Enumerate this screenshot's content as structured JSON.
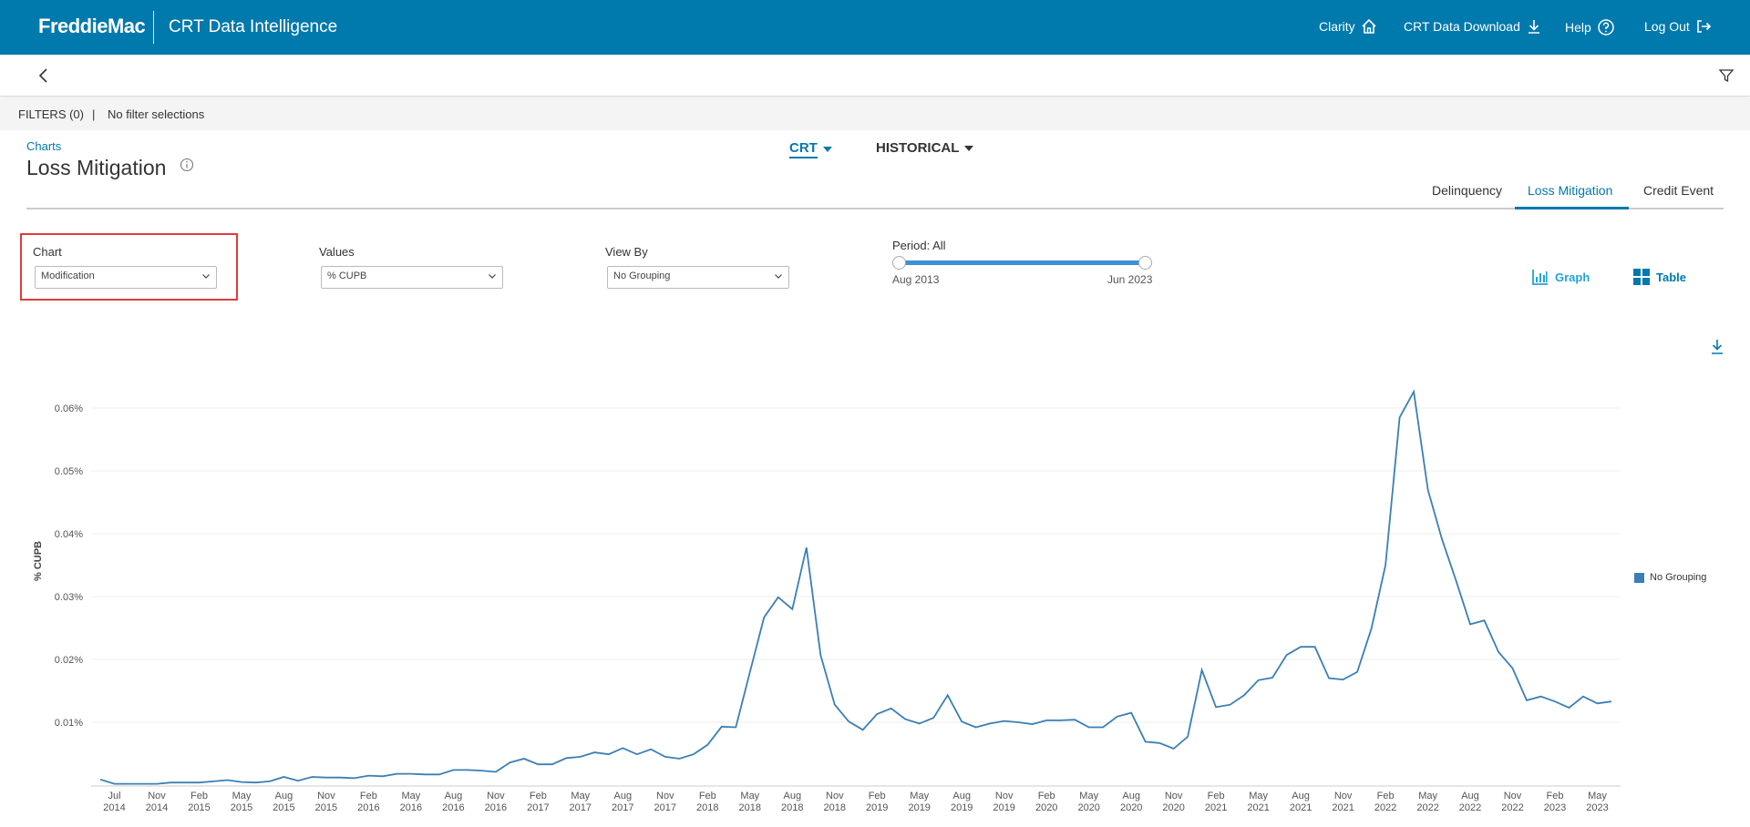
{
  "header": {
    "logo": "FreddieMac",
    "app_title": "CRT Data Intelligence",
    "nav": [
      {
        "label": "Clarity",
        "icon": "home-icon"
      },
      {
        "label": "CRT Data Download",
        "icon": "download-icon"
      },
      {
        "label": "Help",
        "icon": "help-icon"
      },
      {
        "label": "Log Out",
        "icon": "logout-icon"
      }
    ]
  },
  "filters": {
    "label": "FILTERS (0)",
    "separator": "|",
    "status": "No filter selections"
  },
  "page": {
    "breadcrumb": "Charts",
    "title": "Loss Mitigation",
    "dropdown_crt": "CRT",
    "dropdown_historical": "HISTORICAL",
    "tabs": [
      {
        "label": "Delinquency",
        "active": false
      },
      {
        "label": "Loss Mitigation",
        "active": true
      },
      {
        "label": "Credit Event",
        "active": false
      }
    ]
  },
  "controls": {
    "chart": {
      "label": "Chart",
      "value": "Modification"
    },
    "values": {
      "label": "Values",
      "value": "% CUPB"
    },
    "view_by": {
      "label": "View By",
      "value": "No Grouping"
    },
    "period": {
      "label": "Period: All",
      "start": "Aug 2013",
      "end": "Jun 2023"
    },
    "graph_label": "Graph",
    "table_label": "Table"
  },
  "colors": {
    "brand": "#0079ad",
    "line": "#3b7fb5",
    "highlight": "#e23b3b",
    "graph_active": "#23a3d9"
  },
  "chart_data": {
    "type": "line",
    "ylabel": "% CUPB",
    "ylim": [
      0,
      0.065
    ],
    "yticks": [
      0.01,
      0.02,
      0.03,
      0.04,
      0.05,
      0.06
    ],
    "ytick_labels": [
      "0.01%",
      "0.02%",
      "0.03%",
      "0.04%",
      "0.05%",
      "0.06%"
    ],
    "grid": true,
    "legend": {
      "placement": "right",
      "entries": [
        "No Grouping"
      ]
    },
    "x_ticks": [
      [
        "Jul",
        "2014"
      ],
      [
        "Nov",
        "2014"
      ],
      [
        "Feb",
        "2015"
      ],
      [
        "May",
        "2015"
      ],
      [
        "Aug",
        "2015"
      ],
      [
        "Nov",
        "2015"
      ],
      [
        "Feb",
        "2016"
      ],
      [
        "May",
        "2016"
      ],
      [
        "Aug",
        "2016"
      ],
      [
        "Nov",
        "2016"
      ],
      [
        "Feb",
        "2017"
      ],
      [
        "May",
        "2017"
      ],
      [
        "Aug",
        "2017"
      ],
      [
        "Nov",
        "2017"
      ],
      [
        "Feb",
        "2018"
      ],
      [
        "May",
        "2018"
      ],
      [
        "Aug",
        "2018"
      ],
      [
        "Nov",
        "2018"
      ],
      [
        "Feb",
        "2019"
      ],
      [
        "May",
        "2019"
      ],
      [
        "Aug",
        "2019"
      ],
      [
        "Nov",
        "2019"
      ],
      [
        "Feb",
        "2020"
      ],
      [
        "May",
        "2020"
      ],
      [
        "Aug",
        "2020"
      ],
      [
        "Nov",
        "2020"
      ],
      [
        "Feb",
        "2021"
      ],
      [
        "May",
        "2021"
      ],
      [
        "Aug",
        "2021"
      ],
      [
        "Nov",
        "2021"
      ],
      [
        "Feb",
        "2022"
      ],
      [
        "May",
        "2022"
      ],
      [
        "Aug",
        "2022"
      ],
      [
        "Nov",
        "2022"
      ],
      [
        "Feb",
        "2023"
      ],
      [
        "May",
        "2023"
      ]
    ],
    "series": [
      {
        "name": "No Grouping",
        "values": [
          0.0009,
          0.0002,
          0.0002,
          0.0002,
          0.0002,
          0.0004,
          0.0004,
          0.0004,
          0.0006,
          0.0008,
          0.0005,
          0.0004,
          0.0006,
          0.0013,
          0.0007,
          0.0013,
          0.0012,
          0.0012,
          0.0011,
          0.0015,
          0.0014,
          0.0018,
          0.0018,
          0.0017,
          0.0017,
          0.0024,
          0.0024,
          0.0023,
          0.0021,
          0.0036,
          0.0042,
          0.0033,
          0.0033,
          0.0043,
          0.0045,
          0.0052,
          0.0049,
          0.0059,
          0.0049,
          0.0057,
          0.0045,
          0.0042,
          0.0049,
          0.0064,
          0.0093,
          0.0092,
          0.018,
          0.0267,
          0.0299,
          0.028,
          0.0378,
          0.0207,
          0.0128,
          0.0101,
          0.0088,
          0.0113,
          0.0122,
          0.0105,
          0.0098,
          0.0107,
          0.0143,
          0.0101,
          0.0092,
          0.0098,
          0.0102,
          0.01,
          0.0097,
          0.0103,
          0.0103,
          0.0104,
          0.0092,
          0.0092,
          0.0109,
          0.0115,
          0.0069,
          0.0067,
          0.0058,
          0.0077,
          0.0183,
          0.0124,
          0.0128,
          0.0143,
          0.0167,
          0.0171,
          0.0207,
          0.022,
          0.022,
          0.017,
          0.0168,
          0.018,
          0.0249,
          0.035,
          0.0585,
          0.0626,
          0.047,
          0.0391,
          0.0325,
          0.0256,
          0.0262,
          0.0212,
          0.0186,
          0.0135,
          0.0141,
          0.0133,
          0.0123,
          0.0141,
          0.013,
          0.0133
        ]
      }
    ]
  }
}
